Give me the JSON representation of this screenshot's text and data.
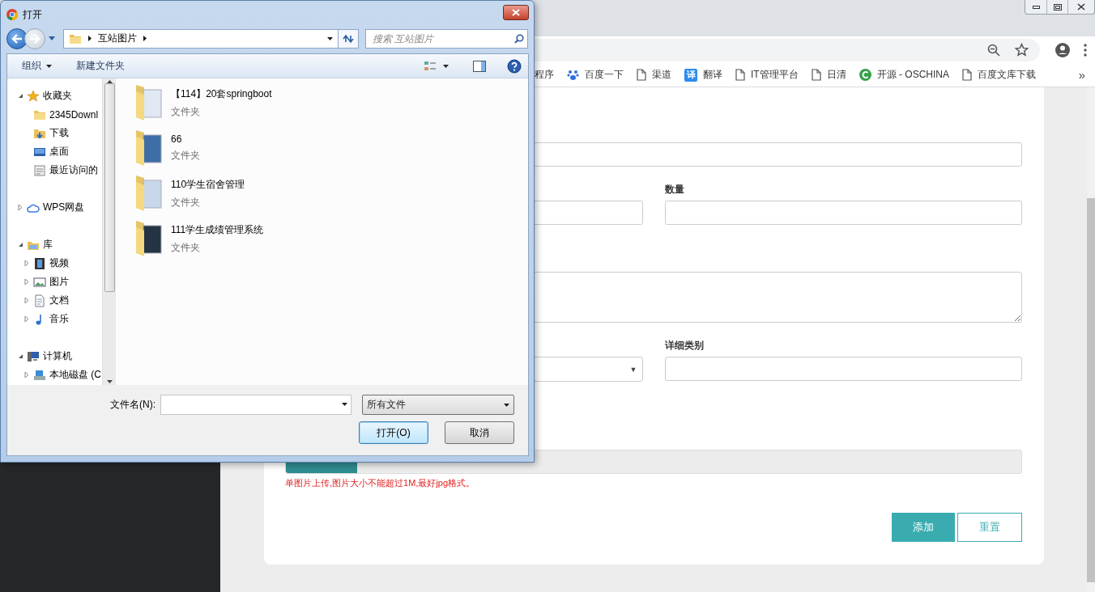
{
  "browser": {
    "bookmarks": [
      {
        "label": "程序",
        "kind": "none"
      },
      {
        "label": "百度一下",
        "kind": "paw"
      },
      {
        "label": "渠道",
        "kind": "page"
      },
      {
        "label": "翻译",
        "kind": "badge",
        "badge": "译"
      },
      {
        "label": "IT管理平台",
        "kind": "page"
      },
      {
        "label": "日清",
        "kind": "page"
      },
      {
        "label": "开源 - OSCHINA",
        "kind": "oschina"
      },
      {
        "label": "百度文库下载",
        "kind": "page"
      }
    ],
    "bookmarks_more": "»"
  },
  "form": {
    "rows": [
      {
        "fields": [
          {
            "kind": "input"
          }
        ]
      },
      {
        "fields": [
          {
            "kind": "input"
          },
          {
            "kind": "input",
            "label": "数量"
          }
        ]
      },
      {
        "fields": [
          {
            "kind": "textarea"
          }
        ]
      },
      {
        "fields": [
          {
            "kind": "select",
            "arrow": "▼"
          },
          {
            "kind": "input",
            "label": "详细类别"
          }
        ]
      },
      {
        "fields": [
          {
            "kind": "file"
          }
        ]
      }
    ],
    "hint": "单图片上传,图片大小不能超过1M,最好jpg格式。",
    "buttons": [
      {
        "label": "添加",
        "kind": "primary"
      },
      {
        "label": "重置",
        "kind": "outline"
      }
    ]
  },
  "dialog": {
    "title": "打开",
    "breadcrumb": [
      "互站图片"
    ],
    "search": {
      "placeholder": "搜索 互站图片"
    },
    "toolbar": [
      {
        "label": "组织",
        "menu": true
      },
      {
        "label": "新建文件夹",
        "menu": false
      }
    ],
    "tree": [
      {
        "label": "收藏夹",
        "kind": "favorites",
        "expanded": true,
        "children": [
          {
            "label": "2345Downl",
            "kind": "folder"
          },
          {
            "label": "下载",
            "kind": "downloads"
          },
          {
            "label": "桌面",
            "kind": "desktop"
          },
          {
            "label": "最近访问的",
            "kind": "recent"
          }
        ]
      },
      {
        "label": "WPS网盘",
        "kind": "cloud",
        "expanded": false
      },
      {
        "label": "库",
        "kind": "library",
        "expanded": true,
        "children": [
          {
            "label": "视频",
            "kind": "video",
            "expanded": false
          },
          {
            "label": "图片",
            "kind": "pictures",
            "expanded": false
          },
          {
            "label": "文档",
            "kind": "documents",
            "expanded": false
          },
          {
            "label": "音乐",
            "kind": "music",
            "expanded": false
          }
        ]
      },
      {
        "label": "计算机",
        "kind": "computer",
        "expanded": true,
        "children": [
          {
            "label": "本地磁盘 (C",
            "kind": "disk",
            "expanded": false
          }
        ]
      }
    ],
    "files": [
      {
        "name": "【114】20套springboot",
        "type": "文件夹"
      },
      {
        "name": "66",
        "type": "文件夹"
      },
      {
        "name": "110学生宿舍管理",
        "type": "文件夹"
      },
      {
        "name": "111学生成绩管理系统",
        "type": "文件夹"
      }
    ],
    "filename_label": "文件名(N):",
    "filter": "所有文件",
    "buttons": [
      {
        "label": "打开(O)",
        "default": true
      },
      {
        "label": "取消",
        "default": false
      }
    ]
  }
}
